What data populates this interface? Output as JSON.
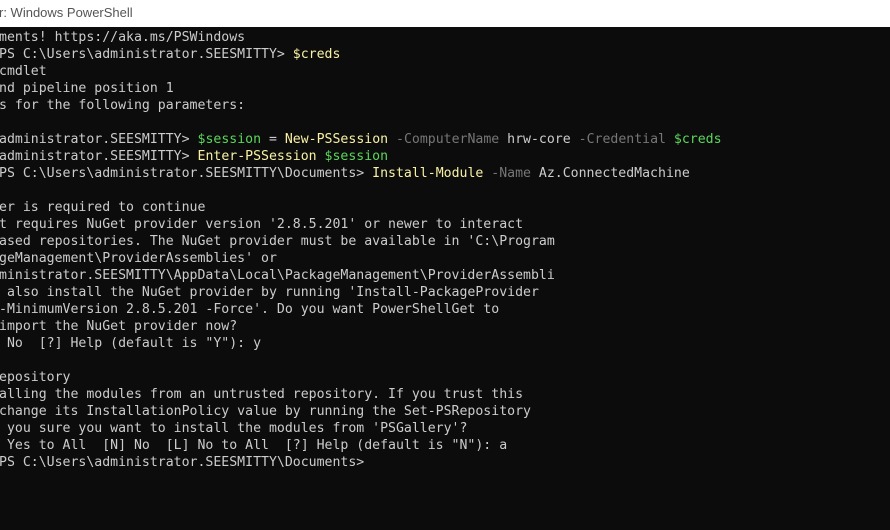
{
  "window": {
    "title": "r: Windows PowerShell"
  },
  "console": {
    "lines": [
      {
        "t": "ments! https://aka.ms/PSWindows"
      },
      {
        "t": "PS C:\\Users\\administrator.SEESMITTY> ",
        "v": "$creds",
        "right": true
      },
      {
        "t": "cmdlet",
        "right": true
      },
      {
        "t": "nd pipeline position 1"
      },
      {
        "t": "s for the following parameters:"
      },
      {
        "t": ""
      },
      {
        "p": "administrator.SEESMITTY> ",
        "v": "$session",
        "e": " = ",
        "c": "New-PSSession",
        "par1": " -ComputerName",
        "a1": " hrw-core",
        "par2": " -Credential",
        "v2": " $creds"
      },
      {
        "p": "administrator.SEESMITTY> ",
        "c": "Enter-PSSession",
        "v": " $session"
      },
      {
        "p": "PS C:\\Users\\administrator.SEESMITTY\\Documents> ",
        "c": "Install-Module",
        "par1": " -Name",
        "a1": " Az.ConnectedMachine"
      },
      {
        "t": ""
      },
      {
        "t": "er is required to continue"
      },
      {
        "t": "t requires NuGet provider version '2.8.5.201' or newer to interact"
      },
      {
        "t": "ased repositories. The NuGet provider must be available in 'C:\\Program"
      },
      {
        "t": "geManagement\\ProviderAssemblies' or"
      },
      {
        "t": "ministrator.SEESMITTY\\AppData\\Local\\PackageManagement\\ProviderAssembli"
      },
      {
        "t": " also install the NuGet provider by running 'Install-PackageProvider"
      },
      {
        "t": "-MinimumVersion 2.8.5.201 -Force'. Do you want PowerShellGet to"
      },
      {
        "t": "import the NuGet provider now?"
      },
      {
        "t": " No  [?] Help (default is \"Y\"): y"
      },
      {
        "t": ""
      },
      {
        "t": "epository"
      },
      {
        "t": "alling the modules from an untrusted repository. If you trust this"
      },
      {
        "t": "change its InstallationPolicy value by running the Set-PSRepository"
      },
      {
        "t": " you sure you want to install the modules from 'PSGallery'?"
      },
      {
        "t": " Yes to All  [N] No  [L] No to All  [?] Help (default is \"N\"): a"
      },
      {
        "t": "PS C:\\Users\\administrator.SEESMITTY\\Documents>"
      }
    ]
  }
}
